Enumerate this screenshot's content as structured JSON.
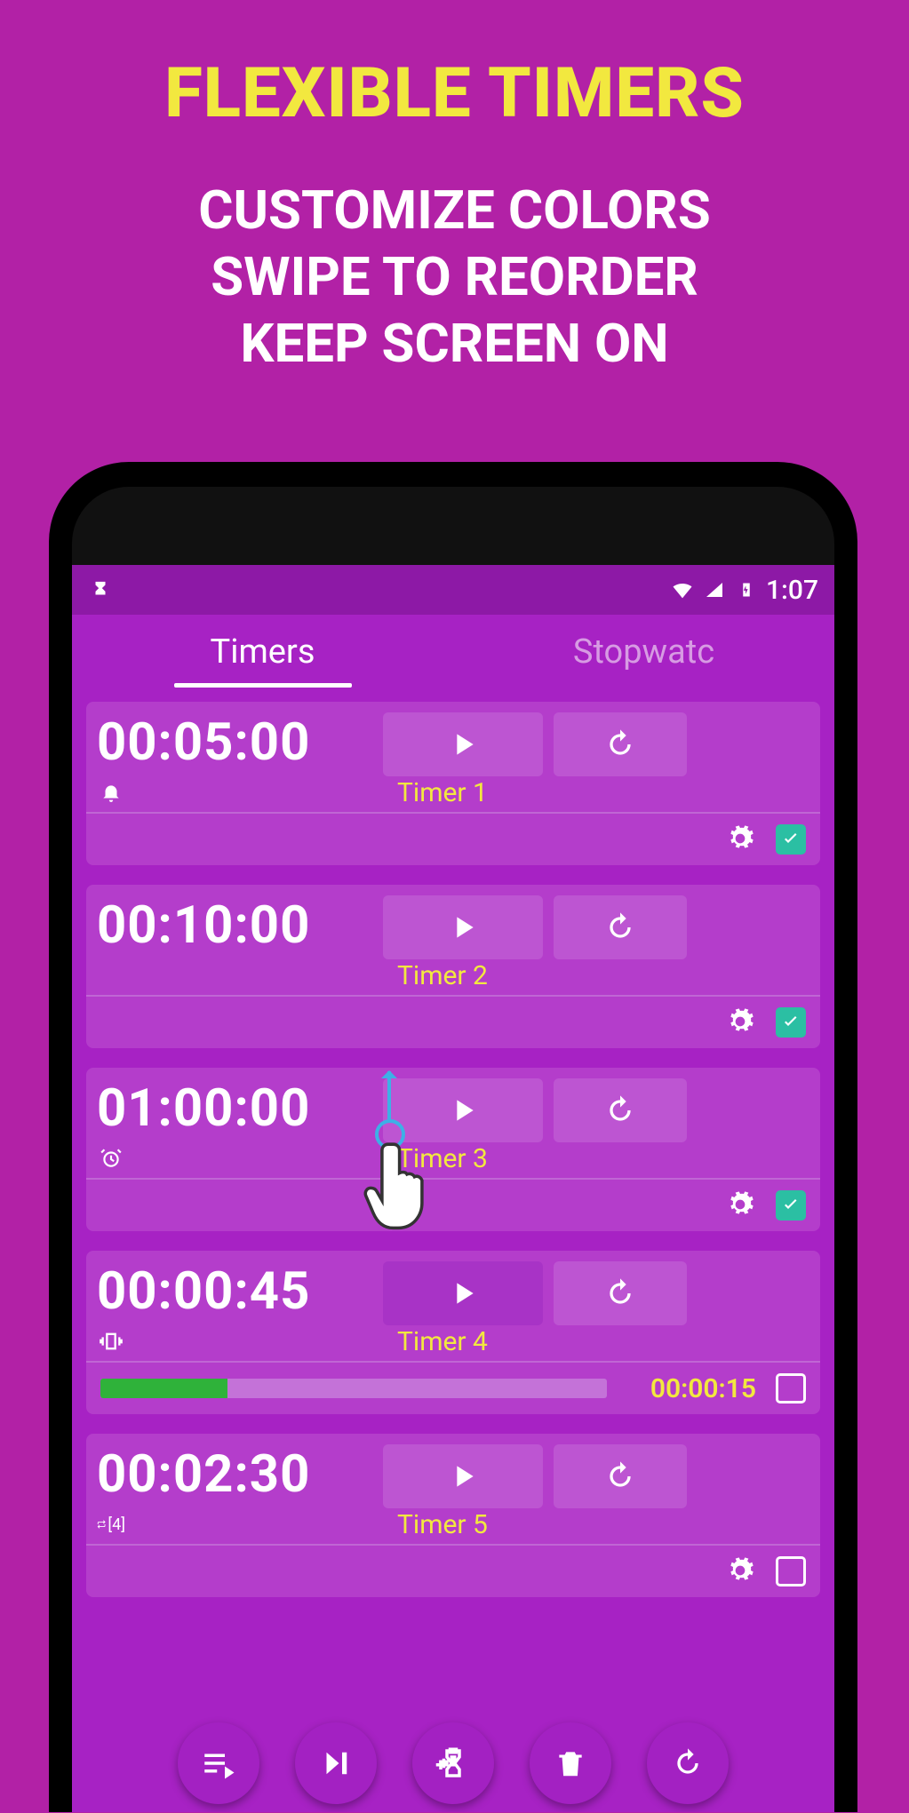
{
  "promo": {
    "title": "FLEXIBLE TIMERS",
    "subtitle": "CUSTOMIZE COLORS\nSWIPE TO REORDER\nKEEP SCREEN ON"
  },
  "statusbar": {
    "clock": "1:07"
  },
  "tabs": {
    "items": [
      {
        "label": "Timers",
        "active": true
      },
      {
        "label": "Stopwatc",
        "active": false
      }
    ]
  },
  "timers": [
    {
      "time": "00:05:00",
      "name": "Timer 1",
      "notify": "bell",
      "checked": true,
      "progress": null,
      "elapsed": null
    },
    {
      "time": "00:10:00",
      "name": "Timer 2",
      "notify": "none",
      "checked": true,
      "progress": null,
      "elapsed": null
    },
    {
      "time": "01:00:00",
      "name": "Timer 3",
      "notify": "clock",
      "checked": true,
      "progress": null,
      "elapsed": null
    },
    {
      "time": "00:00:45",
      "name": "Timer 4",
      "notify": "vibrate",
      "checked": false,
      "progress": 25,
      "elapsed": "00:00:15"
    },
    {
      "time": "00:02:30",
      "name": "Timer 5",
      "notify": "repeat",
      "repeat_count": "[4]",
      "checked": false,
      "progress": null,
      "elapsed": null
    }
  ],
  "colors": {
    "bg": "#b221a6",
    "tabbar": "#a722c4",
    "card": "#b43dcb",
    "accent_yellow": "#f2e83f",
    "teal": "#2bbfa3"
  }
}
